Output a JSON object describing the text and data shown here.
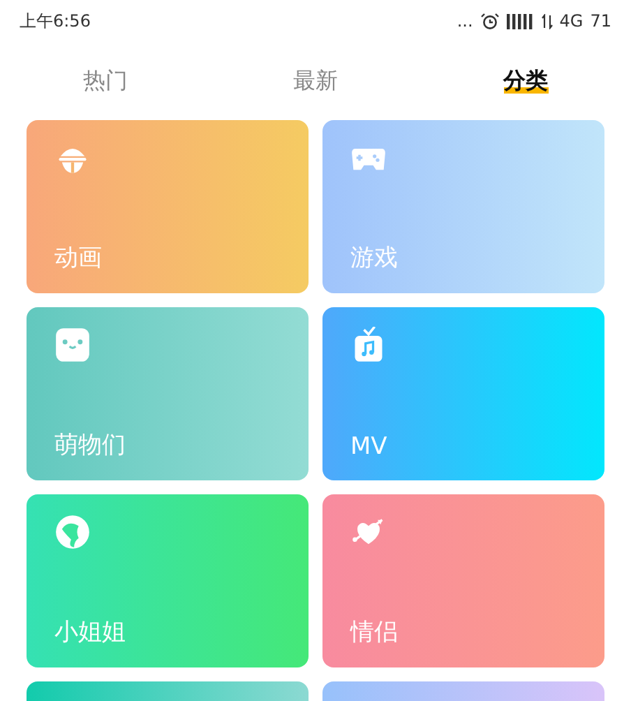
{
  "status_bar": {
    "time": "上午6:56",
    "dots": "...",
    "network": "4G",
    "battery": "71"
  },
  "tabs": [
    {
      "label": "热门",
      "selected": false
    },
    {
      "label": "最新",
      "selected": false
    },
    {
      "label": "分类",
      "selected": true
    }
  ],
  "categories": [
    {
      "label": "动画",
      "color": "#f8a77a"
    },
    {
      "label": "游戏",
      "color": "#9fc3fb"
    },
    {
      "label": "萌物们",
      "color": "#62c8be"
    },
    {
      "label": "MV",
      "color": "#4fa8fb"
    },
    {
      "label": "小姐姐",
      "color": "#35e1b3"
    },
    {
      "label": "情侣",
      "color": "#f88b9f"
    },
    {
      "color": "#12cbac"
    },
    {
      "color": "#97c1fb"
    }
  ]
}
